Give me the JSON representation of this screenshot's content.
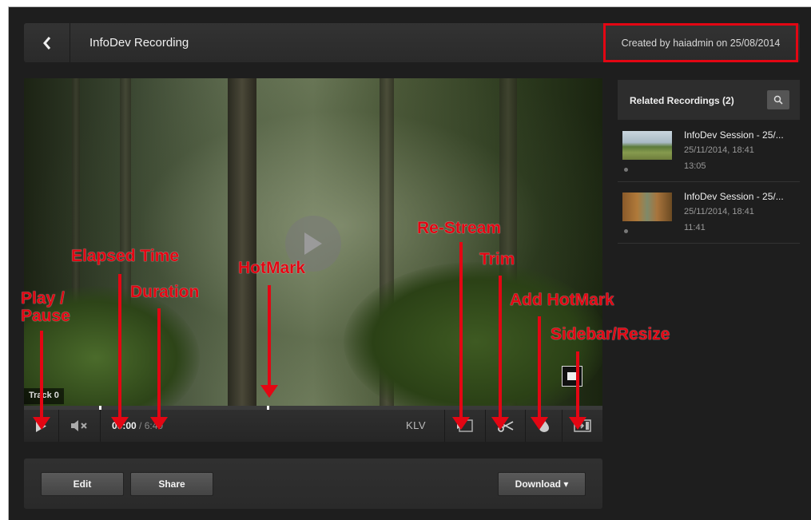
{
  "header": {
    "back_icon": "chevron-left-icon",
    "title": "InfoDev Recording",
    "created": "Created by haiadmin on 25/08/2014"
  },
  "player": {
    "track_label": "Track 0",
    "elapsed": "00:00",
    "duration": "/ 6:40",
    "klv_label": "KLV",
    "icons": {
      "play": "play-icon",
      "mute": "mute-icon",
      "restream": "restream-icon",
      "trim": "scissors-icon",
      "add_hotmark": "flame-icon",
      "sidebar_resize": "sidebar-resize-icon",
      "fullscreen": "fullscreen-icon",
      "big_play": "play-icon"
    }
  },
  "actions": {
    "edit": "Edit",
    "share": "Share",
    "download": "Download ▾"
  },
  "sidebar": {
    "title": "Related Recordings (2)",
    "search_icon": "search-icon",
    "items": [
      {
        "title": "InfoDev Session - 25/...",
        "date": "25/11/2014, 18:41",
        "duration": "13:05"
      },
      {
        "title": "InfoDev Session - 25/...",
        "date": "25/11/2014, 18:41",
        "duration": "11:41"
      }
    ]
  },
  "annotations": {
    "play_pause": "Play /\nPause",
    "elapsed_time": "Elapsed Time",
    "duration": "Duration",
    "hotmark": "HotMark",
    "restream": "Re-Stream",
    "trim": "Trim",
    "add_hotmark": "Add HotMark",
    "sidebar_resize": "Sidebar/Resize"
  },
  "colors": {
    "accent_red": "#e30613",
    "background": "#1e1e1e"
  }
}
